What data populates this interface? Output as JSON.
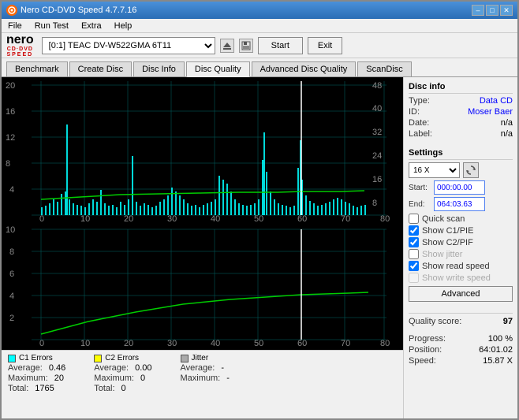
{
  "window": {
    "title": "Nero CD-DVD Speed 4.7.7.16",
    "icon": "cd-icon"
  },
  "title_buttons": {
    "minimize": "–",
    "maximize": "□",
    "close": "✕"
  },
  "menu": {
    "items": [
      "File",
      "Run Test",
      "Extra",
      "Help"
    ]
  },
  "toolbar": {
    "logo_line1": "nero",
    "logo_line2": "CD·DVD",
    "logo_line3": "SPEED",
    "drive_value": "[0:1]  TEAC DV-W522GMA 6T11",
    "start_label": "Start",
    "exit_label": "Exit"
  },
  "tabs": [
    {
      "label": "Benchmark",
      "active": false
    },
    {
      "label": "Create Disc",
      "active": false
    },
    {
      "label": "Disc Info",
      "active": false
    },
    {
      "label": "Disc Quality",
      "active": true
    },
    {
      "label": "Advanced Disc Quality",
      "active": false
    },
    {
      "label": "ScanDisc",
      "active": false
    }
  ],
  "disc_info": {
    "section_title": "Disc info",
    "type_label": "Type:",
    "type_value": "Data CD",
    "id_label": "ID:",
    "id_value": "Moser Baer",
    "date_label": "Date:",
    "date_value": "n/a",
    "label_label": "Label:",
    "label_value": "n/a"
  },
  "settings": {
    "section_title": "Settings",
    "speed_label": "16 X",
    "start_label": "Start:",
    "start_value": "000:00.00",
    "end_label": "End:",
    "end_value": "064:03.63",
    "quick_scan": "Quick scan",
    "show_c1pie": "Show C1/PIE",
    "show_c2pif": "Show C2/PIF",
    "show_jitter": "Show jitter",
    "show_read_speed": "Show read speed",
    "show_write_speed": "Show write speed",
    "advanced_label": "Advanced"
  },
  "checkboxes": {
    "quick_scan": false,
    "c1pie": true,
    "c2pif": true,
    "jitter": false,
    "read_speed": true,
    "write_speed": false
  },
  "quality": {
    "score_label": "Quality score:",
    "score_value": "97"
  },
  "progress": {
    "progress_label": "Progress:",
    "progress_value": "100 %",
    "position_label": "Position:",
    "position_value": "64:01.02",
    "speed_label": "Speed:",
    "speed_value": "15.87 X"
  },
  "legend": {
    "c1": {
      "label": "C1 Errors",
      "color": "#00ffff",
      "avg_label": "Average:",
      "avg_value": "0.46",
      "max_label": "Maximum:",
      "max_value": "20",
      "total_label": "Total:",
      "total_value": "1765"
    },
    "c2": {
      "label": "C2 Errors",
      "color": "#ffff00",
      "avg_label": "Average:",
      "avg_value": "0.00",
      "max_label": "Maximum:",
      "max_value": "0",
      "total_label": "Total:",
      "total_value": "0"
    },
    "jitter": {
      "label": "Jitter",
      "color": "#aaaaaa",
      "avg_label": "Average:",
      "avg_value": "-",
      "max_label": "Maximum:",
      "max_value": "-",
      "total_label": "",
      "total_value": ""
    }
  },
  "chart_top": {
    "y_max": "20",
    "y_values": [
      "20",
      "16",
      "12",
      "8",
      "4"
    ],
    "y2_values": [
      "48",
      "40",
      "32",
      "24",
      "16",
      "8"
    ],
    "x_values": [
      "0",
      "10",
      "20",
      "30",
      "40",
      "50",
      "60",
      "70",
      "80"
    ]
  },
  "chart_bottom": {
    "y_max": "10",
    "y_values": [
      "10",
      "8",
      "6",
      "4",
      "2"
    ],
    "x_values": [
      "0",
      "10",
      "20",
      "30",
      "40",
      "50",
      "60",
      "70",
      "80"
    ]
  }
}
